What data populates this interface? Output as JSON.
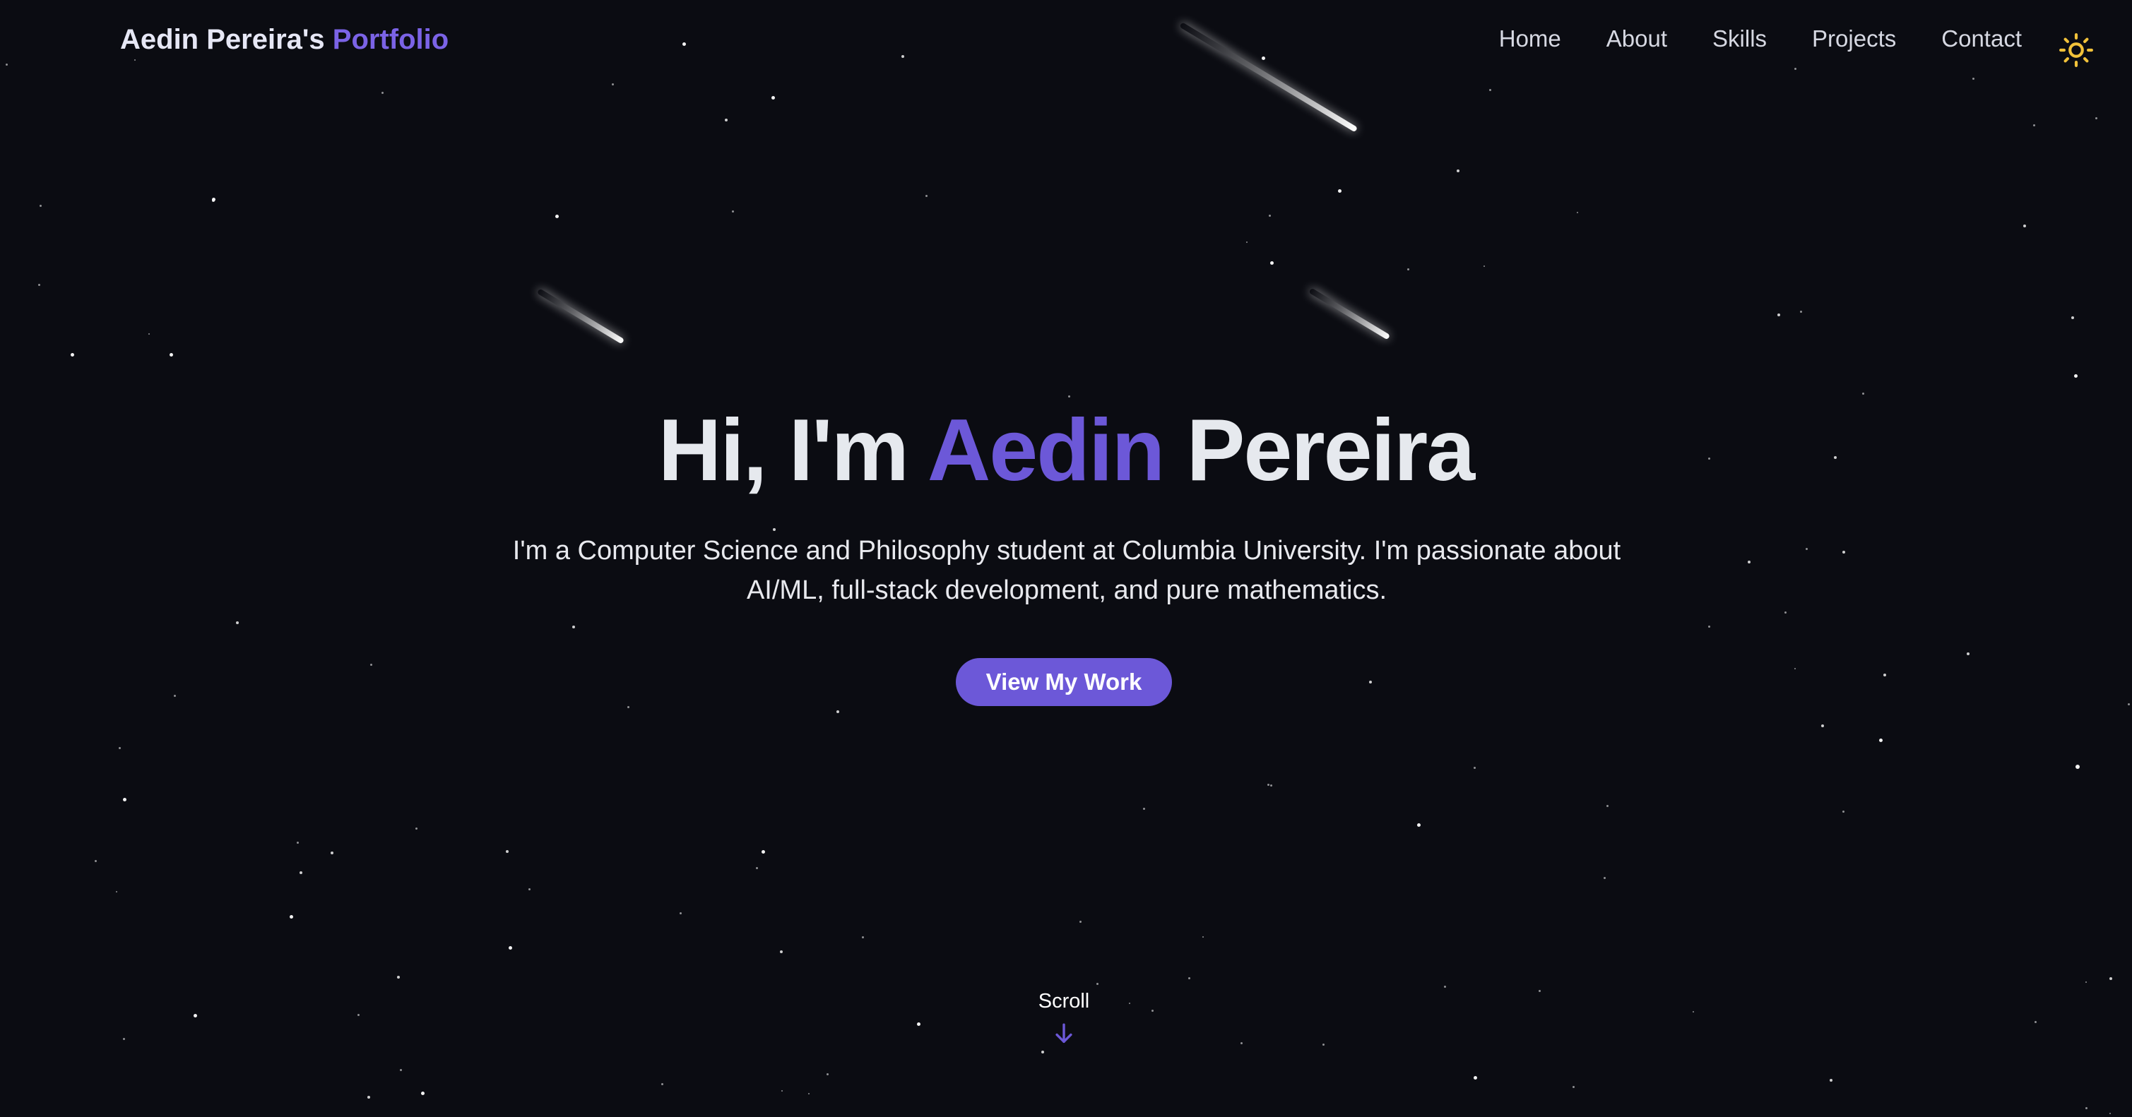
{
  "header": {
    "brand_name": "Aedin Pereira's",
    "brand_accent": "Portfolio",
    "nav": [
      {
        "label": "Home"
      },
      {
        "label": "About"
      },
      {
        "label": "Skills"
      },
      {
        "label": "Projects"
      },
      {
        "label": "Contact"
      }
    ],
    "theme_icon": "sun-icon"
  },
  "hero": {
    "title_prefix": "Hi, I'm",
    "title_highlight": "Aedin",
    "title_suffix": "Pereira",
    "subtitle": "I'm a Computer Science and Philosophy student at Columbia University. I'm passionate about AI/ML, full-stack development, and pure mathematics.",
    "cta_label": "View My Work"
  },
  "scroll": {
    "label": "Scroll",
    "icon": "arrow-down-icon"
  },
  "colors": {
    "background": "#0b0c12",
    "accent": "#6c58d8",
    "sun": "#f2c23a"
  }
}
